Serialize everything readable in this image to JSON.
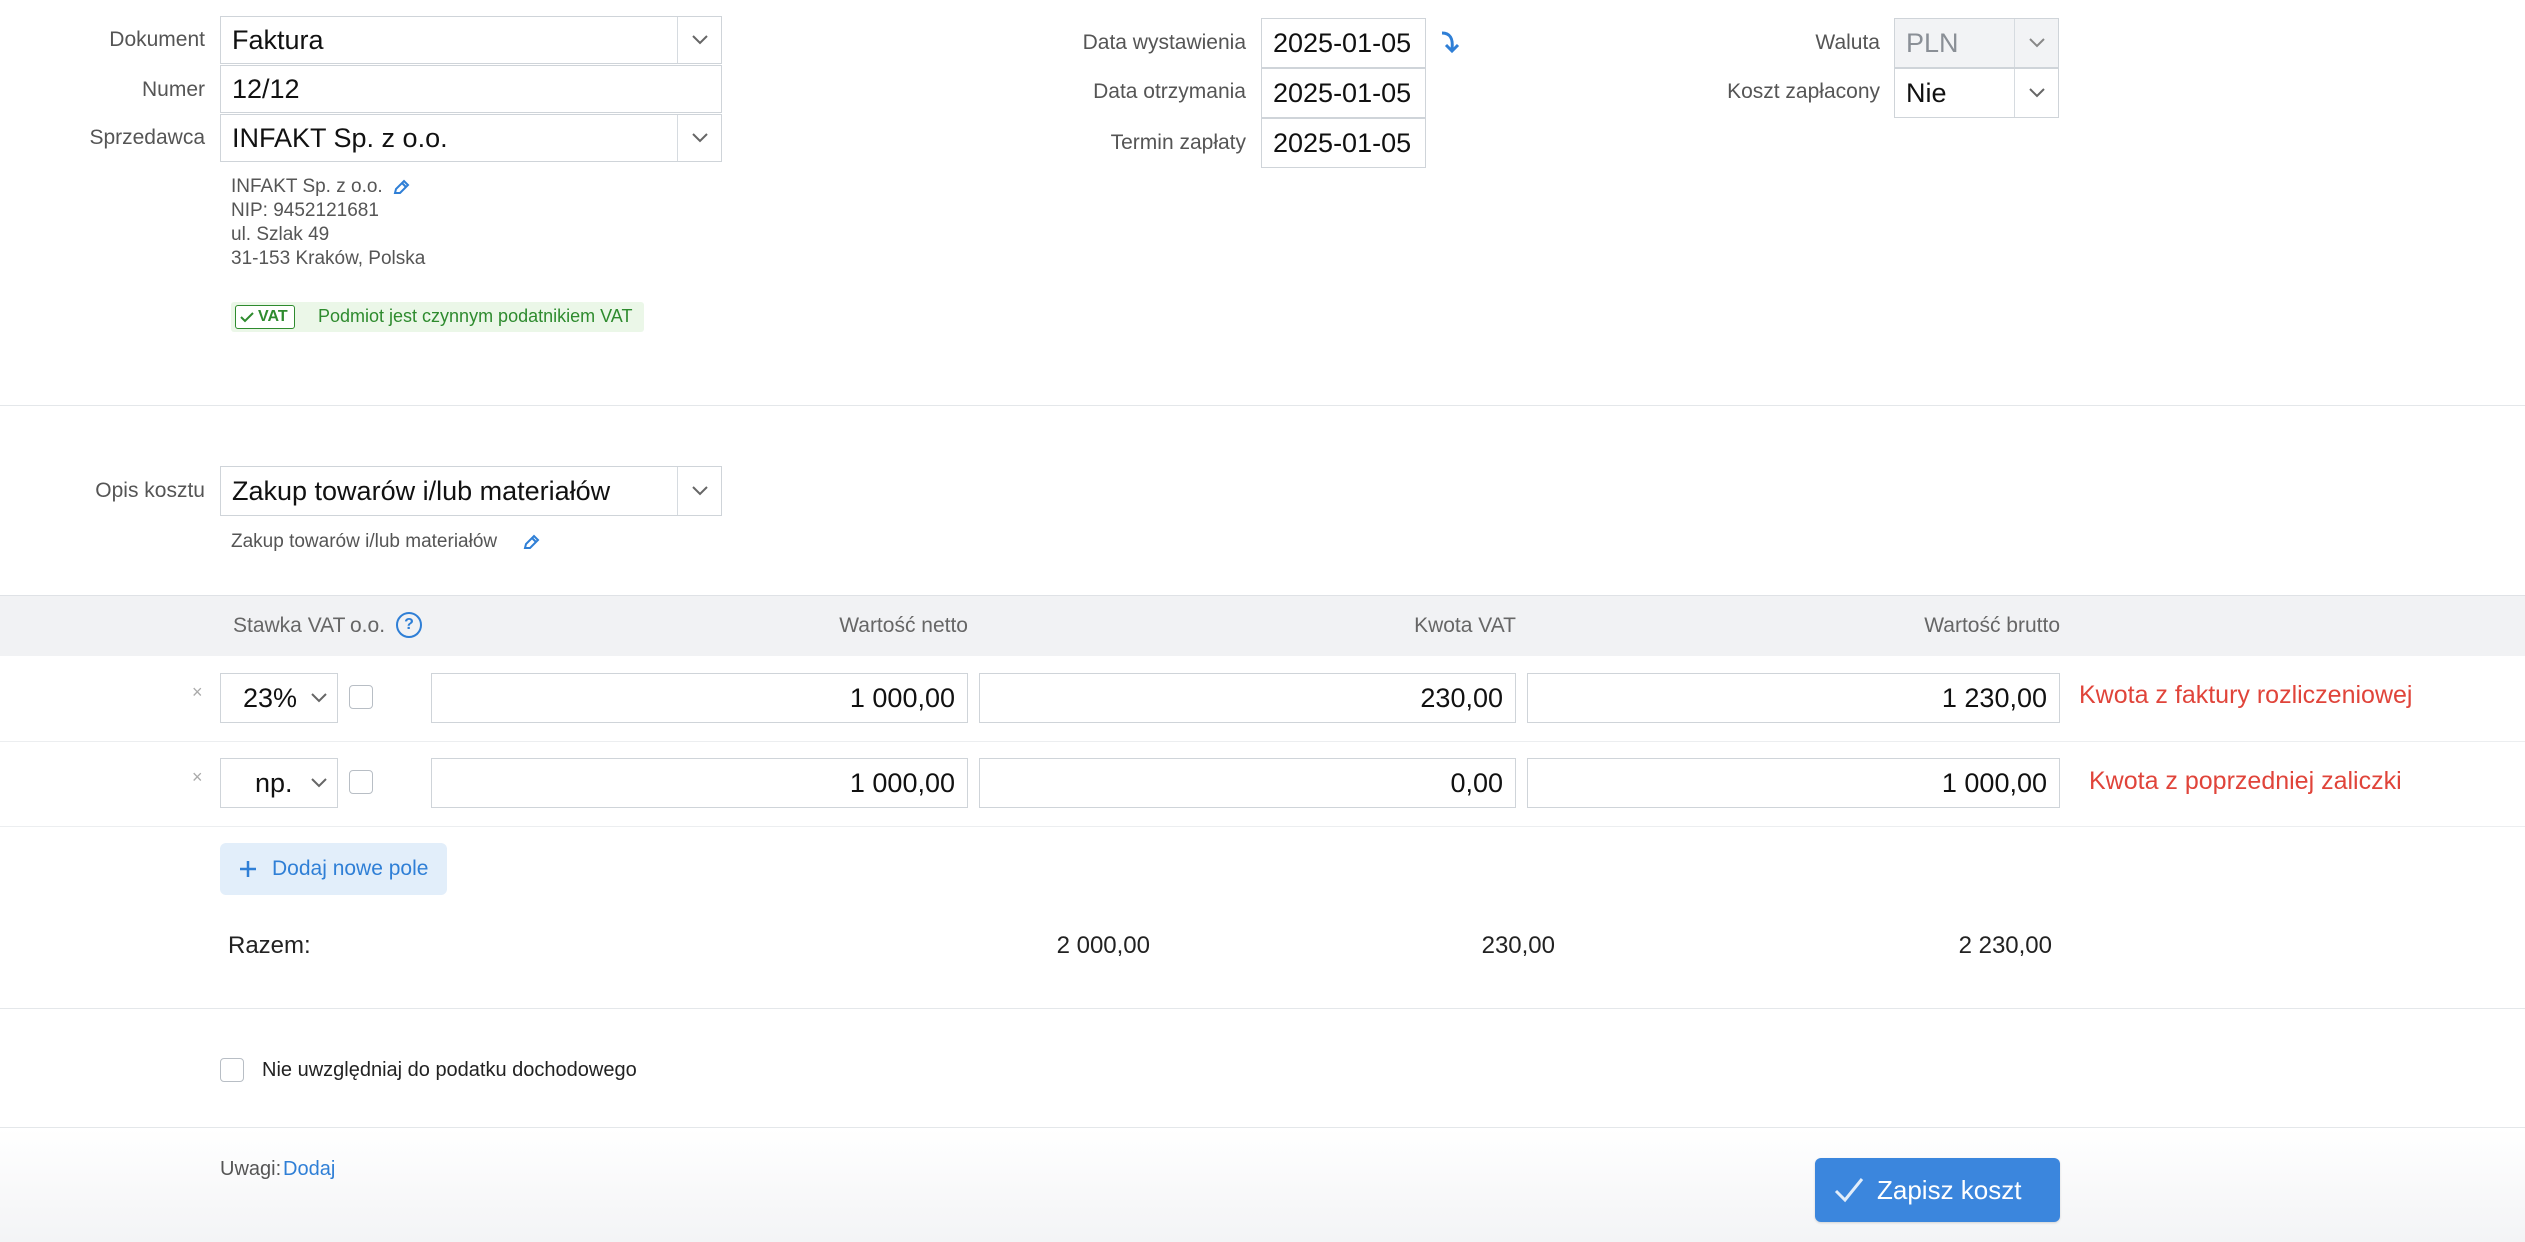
{
  "header": {
    "dokument": {
      "label": "Dokument",
      "value": "Faktura"
    },
    "numer": {
      "label": "Numer",
      "value": "12/12"
    },
    "sprzedawca": {
      "label": "Sprzedawca",
      "value": "INFAKT Sp. z o.o."
    },
    "seller_details": {
      "name": "INFAKT Sp. z o.o.",
      "nip": "NIP: 9452121681",
      "street": "ul. Szlak 49",
      "city": "31-153 Kraków, Polska",
      "vat_badge": "VAT",
      "vat_status": "Podmiot jest czynnym podatnikiem VAT"
    },
    "data_wystawienia": {
      "label": "Data wystawienia",
      "value": "2025-01-05"
    },
    "data_otrzymania": {
      "label": "Data otrzymania",
      "value": "2025-01-05"
    },
    "termin_zaplaty": {
      "label": "Termin zapłaty",
      "value": "2025-01-05"
    },
    "waluta": {
      "label": "Waluta",
      "value": "PLN"
    },
    "koszt_zaplacony": {
      "label": "Koszt zapłacony",
      "value": "Nie"
    }
  },
  "opis": {
    "label": "Opis kosztu",
    "value": "Zakup towarów i/lub materiałów",
    "subtext": "Zakup towarów i/lub materiałów"
  },
  "table": {
    "headers": {
      "stawka": "Stawka VAT",
      "oo": "o.o.",
      "help": "?",
      "netto": "Wartość netto",
      "vat": "Kwota VAT",
      "brutto": "Wartość brutto"
    },
    "rows": [
      {
        "remove": "×",
        "stawka": "23%",
        "netto": "1 000,00",
        "vat": "230,00",
        "brutto": "1 230,00",
        "note": "Kwota z faktury rozliczeniowej"
      },
      {
        "remove": "×",
        "stawka": "np.",
        "netto": "1 000,00",
        "vat": "0,00",
        "brutto": "1 000,00",
        "note": "Kwota z poprzedniej zaliczki"
      }
    ],
    "add_button": "Dodaj nowe pole",
    "totals": {
      "label": "Razem:",
      "netto": "2 000,00",
      "vat": "230,00",
      "brutto": "2 230,00"
    }
  },
  "options": {
    "exclude_income_tax": {
      "label": "Nie uwzględniaj do podatku dochodowego",
      "checked": false
    }
  },
  "footer": {
    "uwagi_label": "Uwagi:",
    "uwagi_link": "Dodaj",
    "save_button": "Zapisz koszt"
  },
  "colors": {
    "accent": "#2f7fd6",
    "note_red": "#e0443a",
    "vat_green": "#2e8b2e",
    "button_bg": "#3b86dd"
  }
}
